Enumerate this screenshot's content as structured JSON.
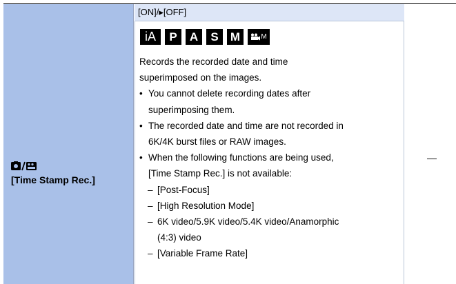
{
  "row": {
    "left": {
      "icon": "camera-movie-mode-icon",
      "title": "[Time Stamp Rec.]"
    },
    "header": "[ON]/▸[OFF]",
    "modes": [
      {
        "label": "iA",
        "icon": ""
      },
      {
        "label": "P",
        "icon": ""
      },
      {
        "label": "A",
        "icon": ""
      },
      {
        "label": "S",
        "icon": ""
      },
      {
        "label": "M",
        "icon": ""
      },
      {
        "label": "M",
        "icon": "movie-camera-icon"
      }
    ],
    "description": [
      "Records the recorded date and time",
      "superimposed on the images."
    ],
    "bullets": [
      [
        "You cannot delete recording dates after",
        "superimposing them."
      ],
      [
        "The recorded date and time are not recorded in",
        "6K/4K burst files or RAW images."
      ],
      [
        "When the following functions are being used,",
        "[Time Stamp Rec.] is not available:"
      ]
    ],
    "sub_items": [
      [
        "[Post-Focus]"
      ],
      [
        "[High Resolution Mode]"
      ],
      [
        "6K video/5.9K video/5.4K video/Anamorphic",
        "(4:3) video"
      ],
      [
        "[Variable Frame Rate]"
      ]
    ],
    "right": "—"
  },
  "colors": {
    "left_bg": "#a9c0e8",
    "header_bg": "#dde6f7",
    "badge_bg": "#000000"
  }
}
